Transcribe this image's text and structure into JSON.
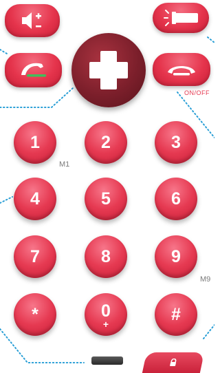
{
  "labels": {
    "m1": "M1",
    "m9": "M9",
    "on_off": "ON/OFF"
  },
  "keys": [
    {
      "label": "1"
    },
    {
      "label": "2"
    },
    {
      "label": "3"
    },
    {
      "label": "4"
    },
    {
      "label": "5"
    },
    {
      "label": "6"
    },
    {
      "label": "7"
    },
    {
      "label": "8"
    },
    {
      "label": "9"
    },
    {
      "label": "*"
    },
    {
      "label": "0",
      "sub": "+"
    },
    {
      "label": "#"
    }
  ],
  "icons": {
    "volume": "volume-plus-minus-icon",
    "torch": "flashlight-icon",
    "call": "call-answer-icon",
    "hangup": "call-end-icon",
    "sos": "sos-cross-icon",
    "lock": "lock-icon"
  },
  "colors": {
    "key_red": "#e5344c",
    "sos_dark": "#7c1f2b",
    "dotted_blue": "#2a9fd6",
    "call_green": "#3fbf5b"
  }
}
